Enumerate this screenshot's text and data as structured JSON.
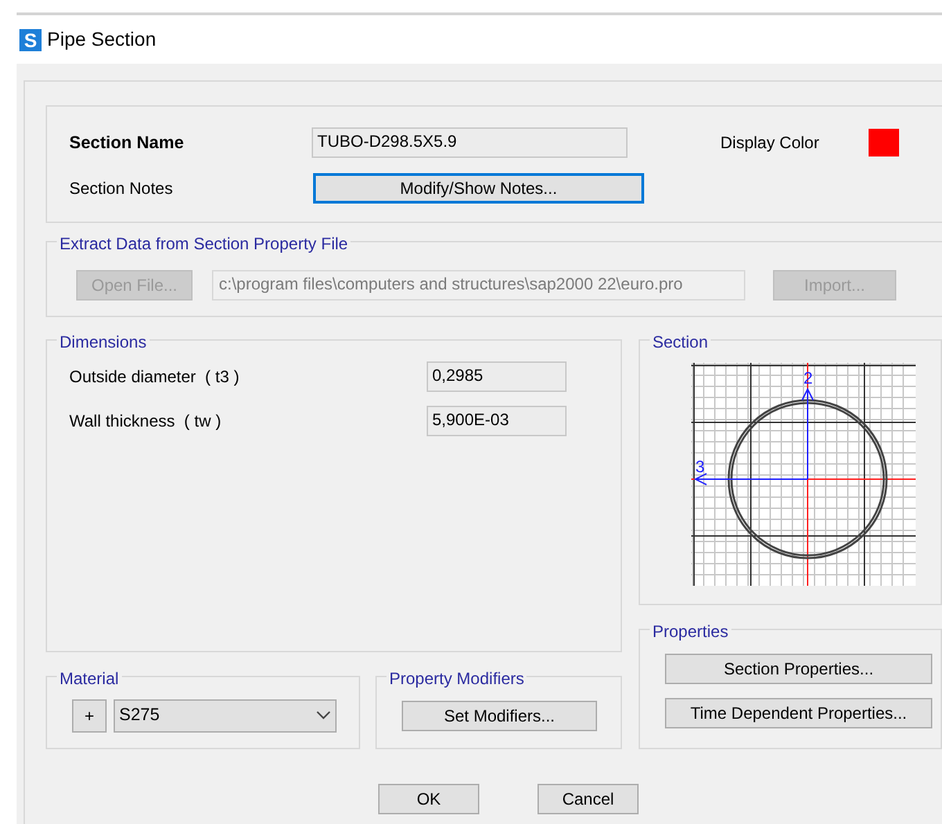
{
  "window": {
    "title": "Pipe Section",
    "app_icon": "S"
  },
  "section_name": {
    "label": "Section Name",
    "value": "TUBO-D298.5X5.9"
  },
  "display_color": {
    "label": "Display Color",
    "color": "#ff0000"
  },
  "section_notes": {
    "label": "Section Notes",
    "button": {
      "label": "Modify/Show Notes...",
      "focused": true
    }
  },
  "extract": {
    "title": "Extract Data from Section Property File",
    "buttons": [
      {
        "label": "Open File...",
        "disabled": true
      },
      {
        "label": "Import...",
        "disabled": true
      }
    ],
    "path": "c:\\program files\\computers and structures\\sap2000 22\\euro.pro"
  },
  "dimensions": {
    "title": "Dimensions",
    "rows": [
      {
        "label": "Outside diameter  ( t3 )",
        "value": "0,2985"
      },
      {
        "label": "Wall thickness  ( tw )",
        "value": "5,900E-03"
      }
    ]
  },
  "section": {
    "title": "Section",
    "axis_labels": [
      "2",
      "3"
    ]
  },
  "properties": {
    "title": "Properties",
    "buttons": [
      "Section Properties...",
      "Time Dependent Properties..."
    ]
  },
  "material": {
    "title": "Material",
    "add_button": "+",
    "value": "S275"
  },
  "property_modifiers": {
    "title": "Property Modifiers",
    "button": "Set Modifiers..."
  },
  "dialog_buttons": [
    "OK",
    "Cancel"
  ]
}
